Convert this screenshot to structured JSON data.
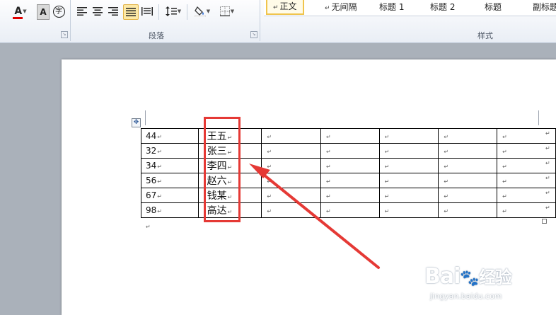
{
  "ribbon": {
    "paragraph_group_label": "段落",
    "styles_group_label": "样式",
    "styles": [
      {
        "label": "正文",
        "selected": true
      },
      {
        "label": "无间隔",
        "selected": false
      },
      {
        "label": "标题 1",
        "selected": false
      },
      {
        "label": "标题 2",
        "selected": false
      },
      {
        "label": "标题",
        "selected": false
      },
      {
        "label": "副标题",
        "selected": false
      }
    ],
    "char_shading_glyph": "A",
    "phonetic_glyph": "字",
    "font_color_glyph": "A",
    "font_color": "#e00000"
  },
  "table": {
    "rows": [
      {
        "num": "44",
        "name": "王五"
      },
      {
        "num": "32",
        "name": "张三"
      },
      {
        "num": "34",
        "name": "李四"
      },
      {
        "num": "56",
        "name": "赵六"
      },
      {
        "num": "67",
        "name": "钱某"
      },
      {
        "num": "98",
        "name": "高达"
      }
    ],
    "return_mark": "↵"
  },
  "annotation": {
    "highlight_color": "#e53935"
  },
  "watermark": {
    "brand": "Bai",
    "brand_tail": "经验",
    "url": "jingyan.baidu.com"
  }
}
